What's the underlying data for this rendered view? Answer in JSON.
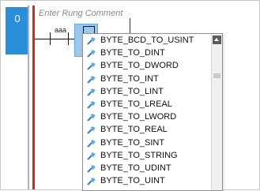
{
  "rung": {
    "number": "0",
    "comment_placeholder": "Enter Rung Comment"
  },
  "contact": {
    "label": "aaa"
  },
  "instruction_list": {
    "items": [
      "BYTE_BCD_TO_USINT",
      "BYTE_TO_DINT",
      "BYTE_TO_DWORD",
      "BYTE_TO_INT",
      "BYTE_TO_LINT",
      "BYTE_TO_LREAL",
      "BYTE_TO_LWORD",
      "BYTE_TO_REAL",
      "BYTE_TO_SINT",
      "BYTE_TO_STRING",
      "BYTE_TO_UDINT",
      "BYTE_TO_UINT"
    ],
    "item_icon": "function-block-icon"
  },
  "colors": {
    "rung_badge": "#2a8fd8",
    "power_rail": "#d0281e",
    "selected_instruction": "#9cc7ec"
  }
}
